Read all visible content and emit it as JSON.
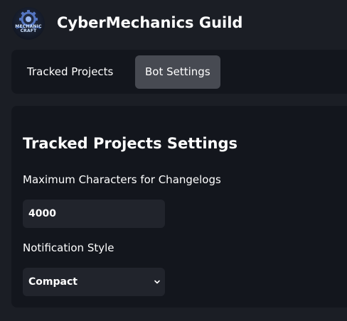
{
  "header": {
    "logo": {
      "line1": "MECHANIC",
      "line2": "CRAFT",
      "icon": "gear-logo-icon"
    },
    "guild_name": "CyberMechanics Guild"
  },
  "tabs": [
    {
      "label": "Tracked Projects",
      "active": false
    },
    {
      "label": "Bot Settings",
      "active": true
    }
  ],
  "panel": {
    "title": "Tracked Projects Settings",
    "fields": {
      "max_chars": {
        "label": "Maximum Characters for Changelogs",
        "value": "4000"
      },
      "notification_style": {
        "label": "Notification Style",
        "selected": "Compact",
        "icon": "chevron-down-icon"
      }
    }
  },
  "colors": {
    "background": "#1b1e25",
    "panel": "#13161d",
    "active_tab": "#474a52",
    "input": "#21242c",
    "text": "#ffffff"
  }
}
